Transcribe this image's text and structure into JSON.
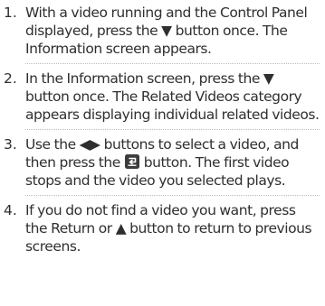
{
  "steps": [
    {
      "number": "1.",
      "text": "With a video running and the Control Panel displayed, press the ▼ button once. The Information screen appears."
    },
    {
      "number": "2.",
      "text": "In the Information screen, press the ▼ button once. The Related Videos category appears displaying individual related videos."
    },
    {
      "number": "3.",
      "text_before_icon": "Use the ◀▶ buttons to select a video, and then press the",
      "icon": "enter-icon",
      "text_after_icon": " button. The first video stops and the video you selected plays."
    },
    {
      "number": "4.",
      "text": "If you do not find a video you want, press the Return or ▲ button to return to previous screens."
    }
  ]
}
